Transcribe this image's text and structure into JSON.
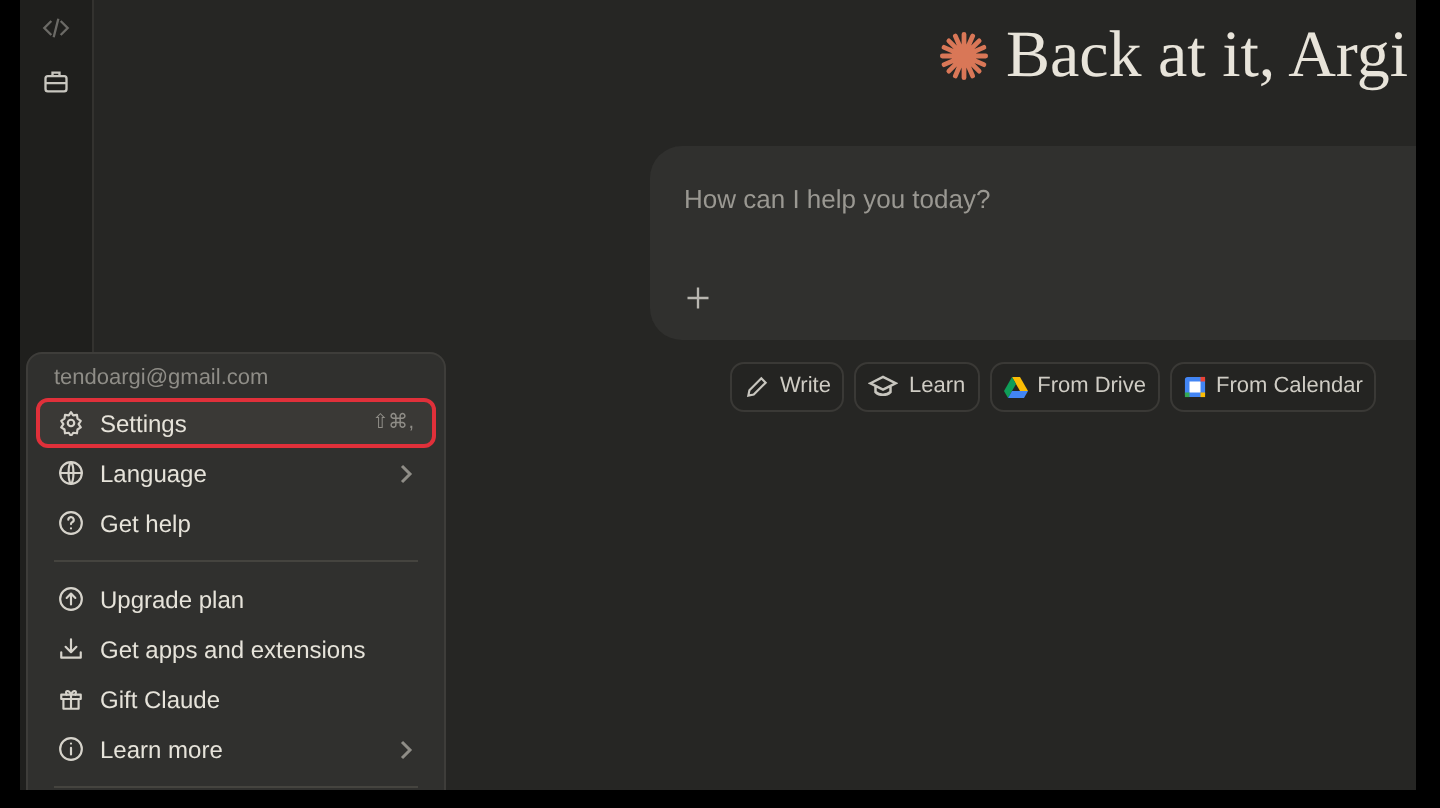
{
  "greeting": {
    "title": "Back at it, Argi"
  },
  "composer": {
    "placeholder": "How can I help you today?"
  },
  "actions": [
    {
      "label": "Write",
      "kind": "write"
    },
    {
      "label": "Learn",
      "kind": "learn"
    },
    {
      "label": "From Drive",
      "kind": "drive"
    },
    {
      "label": "From Calendar",
      "kind": "calendar"
    }
  ],
  "account_menu": {
    "email": "tendoargi@gmail.com",
    "groups": [
      [
        {
          "label": "Settings",
          "kind": "gear",
          "shortcut": "⇧⌘,",
          "submenu": false,
          "selected": true
        },
        {
          "label": "Language",
          "kind": "globe",
          "submenu": true,
          "selected": false
        },
        {
          "label": "Get help",
          "kind": "help",
          "submenu": false,
          "selected": false
        }
      ],
      [
        {
          "label": "Upgrade plan",
          "kind": "upgrade",
          "submenu": false,
          "selected": false
        },
        {
          "label": "Get apps and extensions",
          "kind": "download",
          "submenu": false,
          "selected": false
        },
        {
          "label": "Gift Claude",
          "kind": "gift",
          "submenu": false,
          "selected": false
        },
        {
          "label": "Learn more",
          "kind": "info",
          "submenu": true,
          "selected": false
        }
      ]
    ]
  }
}
